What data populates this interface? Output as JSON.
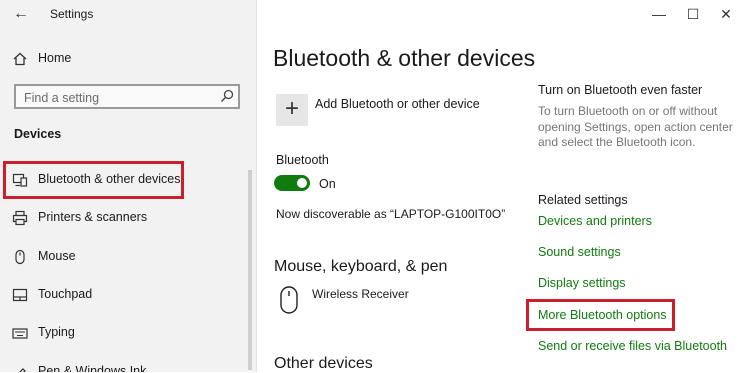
{
  "window": {
    "title": "Settings",
    "back_glyph": "←",
    "minimize_glyph": "—",
    "maximize_glyph": "☐",
    "close_glyph": "✕"
  },
  "sidebar": {
    "home": {
      "label": "Home",
      "icon": "home-icon"
    },
    "search": {
      "placeholder": "Find a setting",
      "icon": "search-icon"
    },
    "section_heading": "Devices",
    "items": [
      {
        "label": "Bluetooth & other devices",
        "icon": "bluetooth-devices-icon",
        "selected": true
      },
      {
        "label": "Printers & scanners",
        "icon": "printer-icon"
      },
      {
        "label": "Mouse",
        "icon": "mouse-icon"
      },
      {
        "label": "Touchpad",
        "icon": "touchpad-icon"
      },
      {
        "label": "Typing",
        "icon": "keyboard-icon"
      },
      {
        "label": "Pen & Windows Ink",
        "icon": "pen-icon"
      }
    ]
  },
  "main": {
    "title": "Bluetooth & other devices",
    "add_device": {
      "plus": "+",
      "label": "Add Bluetooth or other device"
    },
    "bluetooth": {
      "label": "Bluetooth",
      "state": "On",
      "on": true
    },
    "discoverable": "Now discoverable as “LAPTOP-G100IT0O”",
    "mouse_section": {
      "title": "Mouse, keyboard, & pen",
      "device": "Wireless Receiver"
    },
    "other_section": {
      "title": "Other devices"
    }
  },
  "right_panel": {
    "faster_heading": "Turn on Bluetooth even faster",
    "faster_desc": "To turn Bluetooth on or off without opening Settings, open action center and select the Bluetooth icon.",
    "related_heading": "Related settings",
    "links": [
      {
        "label": "Devices and printers"
      },
      {
        "label": "Sound settings"
      },
      {
        "label": "Display settings"
      },
      {
        "label": "More Bluetooth options",
        "highlighted": true
      },
      {
        "label": "Send or receive files via Bluetooth"
      }
    ]
  },
  "colors": {
    "accent": "#107c10",
    "highlight_border": "#cc1f2d",
    "sidebar_bg": "#f2f2f2"
  }
}
